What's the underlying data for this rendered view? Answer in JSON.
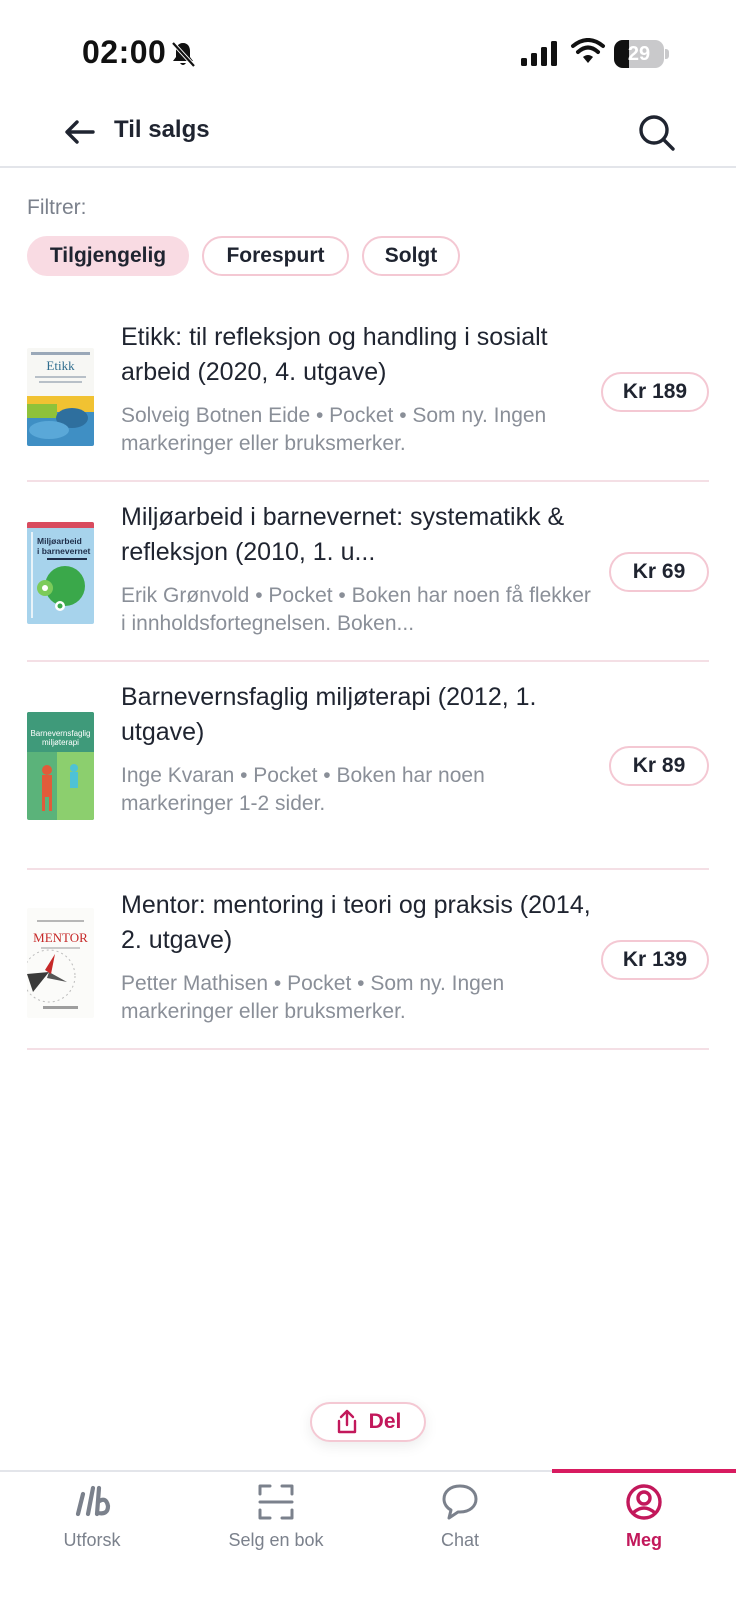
{
  "status_bar": {
    "time": "02:00",
    "battery_level": "29",
    "battery_fraction": 0.29,
    "icons": [
      "bell-slash-icon",
      "signal-icon",
      "wifi-icon",
      "battery-icon"
    ]
  },
  "header": {
    "title": "Til salgs",
    "back_icon": "arrow-left-icon",
    "search_icon": "search-icon"
  },
  "filters": {
    "label": "Filtrer:",
    "chips": [
      {
        "label": "Tilgjengelig",
        "active": true
      },
      {
        "label": "Forespurt",
        "active": false
      },
      {
        "label": "Solgt",
        "active": false
      }
    ]
  },
  "books": [
    {
      "title": "Etikk: til refleksjon og handling i sosialt arbeid (2020, 4. utgave)",
      "meta": "Solveig Botnen Eide • Pocket • Som ny. Ingen markeringer eller bruksmerker.",
      "price": "Kr 189",
      "cover_text": "Etikk"
    },
    {
      "title": "Miljøarbeid i barnevernet: systematikk & refleksjon (2010, 1. u...",
      "meta": "Erik Grønvold • Pocket • Boken har noen få flekker i innholdsfortegnelsen. Boken...",
      "price": "Kr 69",
      "cover_text": "Miljøarbeid i barnevernet"
    },
    {
      "title": "Barnevernsfaglig miljøterapi (2012, 1. utgave)",
      "meta": "Inge Kvaran • Pocket • Boken har noen markeringer 1-2 sider.",
      "price": "Kr 89",
      "cover_text": "Barnevernsfaglig miljøterapi"
    },
    {
      "title": "Mentor: mentoring i teori og praksis (2014, 2. utgave)",
      "meta": "Petter Mathisen • Pocket • Som ny. Ingen markeringer eller bruksmerker.",
      "price": "Kr 139",
      "cover_text": "MENTOR"
    }
  ],
  "share_button": {
    "label": "Del",
    "icon": "share-icon"
  },
  "bottom_nav": {
    "items": [
      {
        "label": "Utforsk",
        "icon": "lb-logo-icon",
        "active": false
      },
      {
        "label": "Selg en bok",
        "icon": "scan-icon",
        "active": false
      },
      {
        "label": "Chat",
        "icon": "chat-bubble-icon",
        "active": false
      },
      {
        "label": "Meg",
        "icon": "user-circle-icon",
        "active": true
      }
    ]
  },
  "colors": {
    "accent": "#d81b60",
    "accent_text": "#c2185b",
    "chip_active_bg": "#f9dbe3",
    "chip_border": "#f4c8d3",
    "muted_text": "#8a8f98"
  }
}
